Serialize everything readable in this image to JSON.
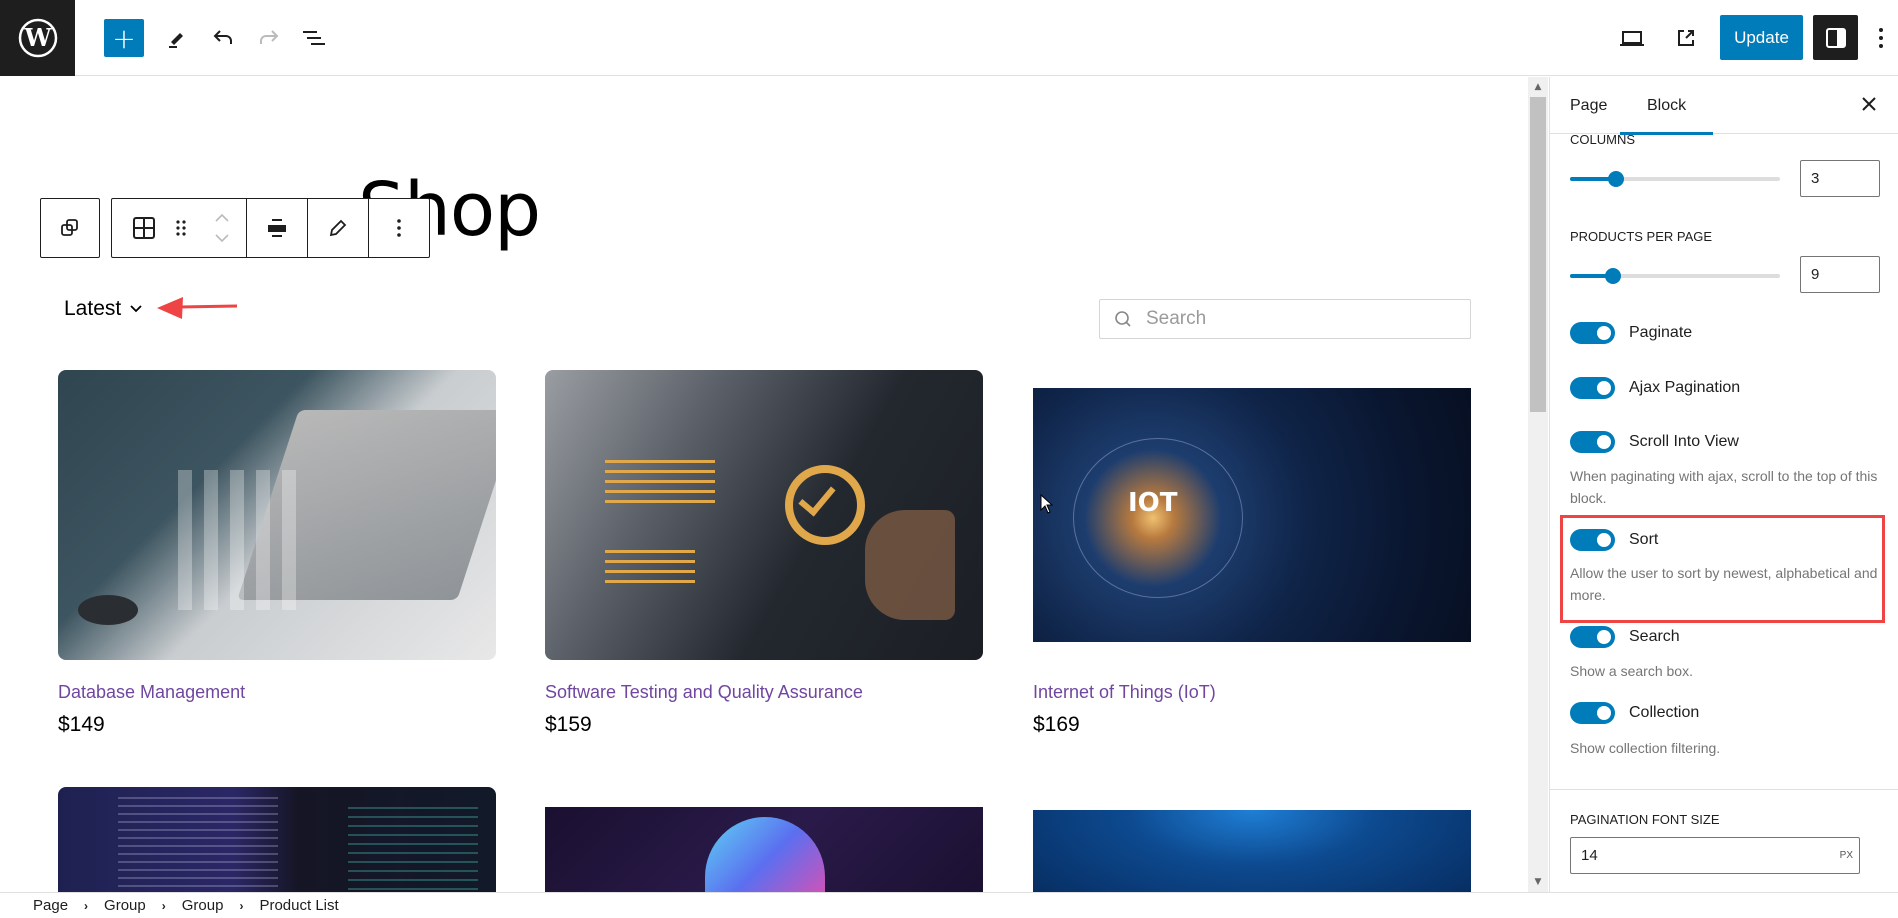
{
  "topbar": {
    "logo": "wordpress-logo",
    "toolbar_icons": [
      "plus-icon",
      "pencil-icon",
      "undo-icon",
      "redo-icon",
      "list-view-icon"
    ],
    "update_label": "Update",
    "right_icons": [
      "desktop-preview-icon",
      "external-link-icon",
      "settings-panel-icon",
      "more-vertical-icon"
    ],
    "accent_color": "#007cba"
  },
  "canvas": {
    "page_title": "Shop",
    "block_toolbar": [
      "parent-block-icon",
      "grid-icon",
      "drag-handle-icon",
      "move-up-down-icon",
      "align-icon",
      "edit-icon",
      "more-options-icon"
    ],
    "sort": {
      "selected": "Latest"
    },
    "search": {
      "placeholder": "Search",
      "value": ""
    },
    "products": [
      {
        "title": "Database Management",
        "price": "$149"
      },
      {
        "title": "Software Testing and Quality Assurance",
        "price": "$159"
      },
      {
        "title": "Internet of Things (IoT)",
        "price": "$169"
      },
      {
        "title": "",
        "price": ""
      },
      {
        "title": "",
        "price": ""
      },
      {
        "title": "",
        "price": ""
      }
    ],
    "product_link_color": "#7046a0"
  },
  "breadcrumb": [
    "Page",
    "Group",
    "Group",
    "Product List"
  ],
  "sidebar": {
    "tabs": [
      {
        "label": "Page",
        "active": false
      },
      {
        "label": "Block",
        "active": true
      }
    ],
    "columns": {
      "label": "COLUMNS",
      "value": "3",
      "slider_fraction": 0.18
    },
    "per_page": {
      "label": "PRODUCTS PER PAGE",
      "value": "9",
      "slider_fraction": 0.17
    },
    "toggles": [
      {
        "label": "Paginate",
        "on": true,
        "help": ""
      },
      {
        "label": "Ajax Pagination",
        "on": true,
        "help": ""
      },
      {
        "label": "Scroll Into View",
        "on": true,
        "help": "When paginating with ajax, scroll to the top of this block."
      },
      {
        "label": "Sort",
        "on": true,
        "help": "Allow the user to sort by newest, alphabetical and more."
      },
      {
        "label": "Search",
        "on": true,
        "help": "Show a search box."
      },
      {
        "label": "Collection",
        "on": true,
        "help": "Show collection filtering."
      }
    ],
    "pagination_font_size": {
      "label": "PAGINATION FONT SIZE",
      "value": "14",
      "unit": "PX"
    },
    "highlight_color": "#ef4444"
  }
}
